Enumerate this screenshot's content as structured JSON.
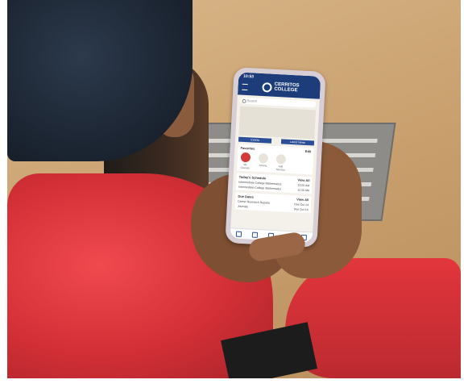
{
  "phone": {
    "status_time": "10:53",
    "brand_line1": "CERRITOS",
    "brand_line2": "COLLEGE",
    "search_placeholder": "Search",
    "banner_buttons": [
      "Events",
      "Latest News"
    ],
    "favorites": {
      "title": "Favorites",
      "action": "Edit",
      "items": [
        "My Courses",
        "Activity",
        "Add Shortcut"
      ]
    },
    "schedule": {
      "title": "Today's Schedule",
      "action": "View All",
      "items": [
        {
          "label": "Intermediate College Mathematics",
          "meta": "10:00 AM"
        },
        {
          "label": "Intermediate College Mathematics",
          "meta": "11:30 AM"
        }
      ]
    },
    "due_dates": {
      "title": "Due Dates",
      "action": "View All",
      "items": [
        {
          "label": "Career Research Reports",
          "meta": "Due Oct 14"
        },
        {
          "label": "Journals",
          "meta": "Due Oct 16"
        }
      ]
    },
    "tabbar_icons": [
      "home-icon",
      "profile-icon",
      "discover-icon",
      "notifications-icon",
      "account-icon"
    ]
  }
}
